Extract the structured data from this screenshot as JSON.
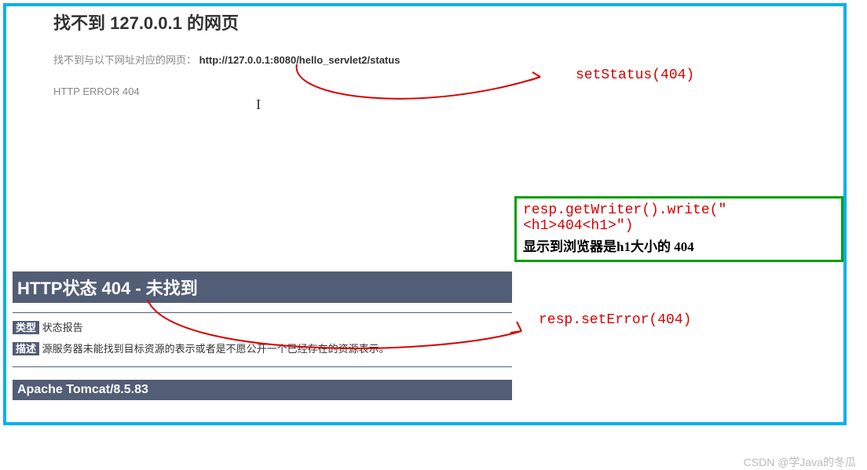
{
  "top": {
    "title": "找不到 127.0.0.1 的网页",
    "not_found_prefix": "找不到与以下网址对应的网页：",
    "url": "http://127.0.0.1:8080/hello_servlet2/status",
    "http_error": "HTTP ERROR 404"
  },
  "annotations": {
    "set_status": "setStatus(404)",
    "set_error": "resp.setError(404)"
  },
  "green_box": {
    "code": "resp.getWriter().write(\"<h1>404<h1>\")",
    "desc": "显示到浏览器是h1大小的 404"
  },
  "tomcat": {
    "header": "HTTP状态 404 - 未找到",
    "type_label": "类型",
    "type_value": "状态报告",
    "desc_label": "描述",
    "desc_value": "源服务器未能找到目标资源的表示或者是不愿公开一个已经存在的资源表示。",
    "footer": "Apache Tomcat/8.5.83"
  },
  "watermark": "CSDN @学Java的冬瓜"
}
